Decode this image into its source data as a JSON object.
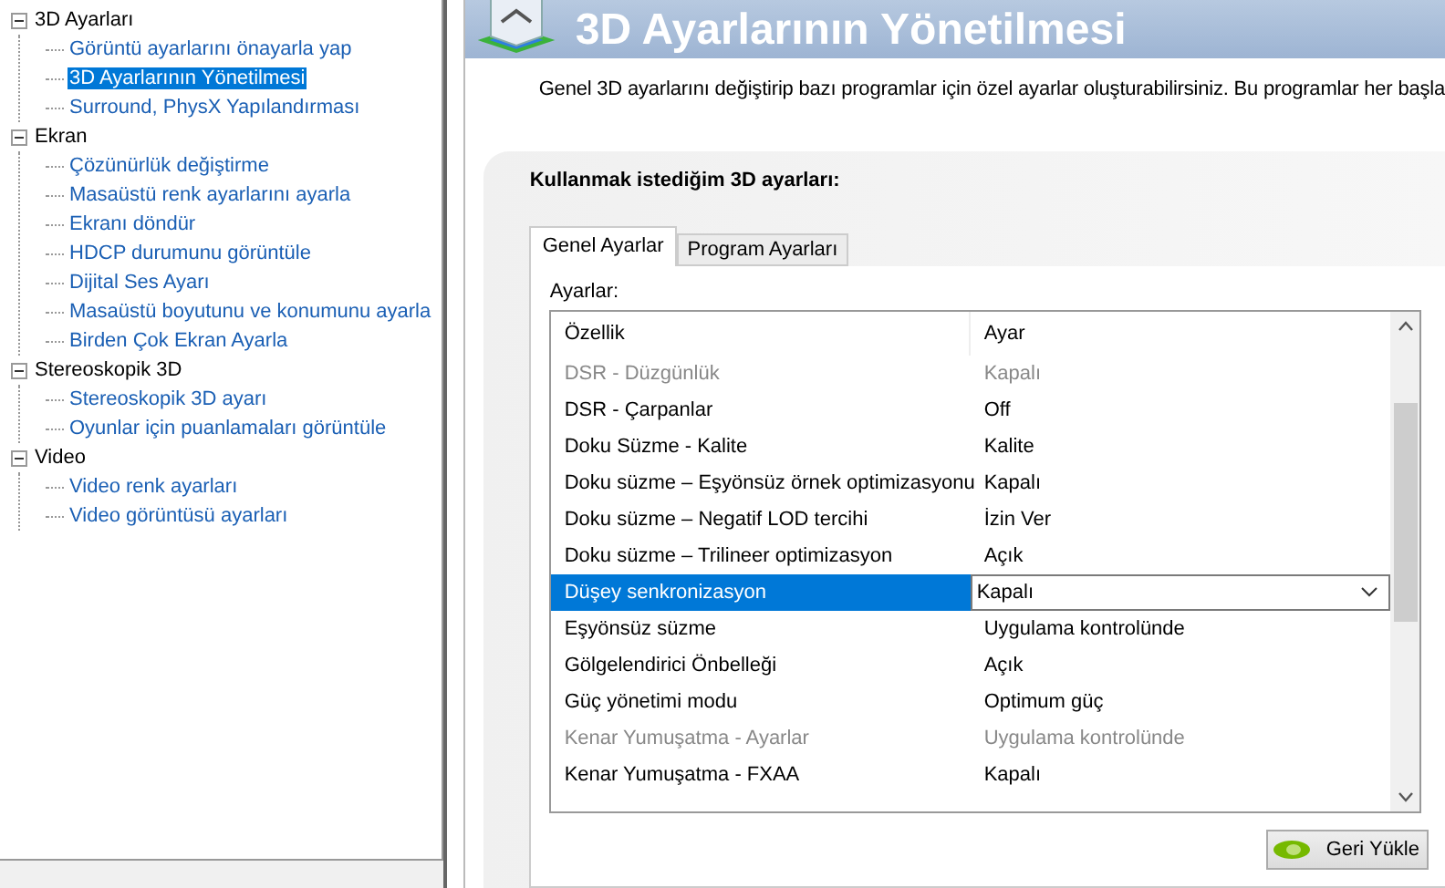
{
  "tree": [
    {
      "label": "3D Ayarları",
      "expanded": true,
      "selected": false,
      "children": [
        {
          "label": "Görüntü ayarlarını önayarla yap",
          "selected": false
        },
        {
          "label": "3D Ayarlarının Yönetilmesi",
          "selected": true
        },
        {
          "label": "Surround, PhysX Yapılandırması",
          "selected": false
        }
      ]
    },
    {
      "label": "Ekran",
      "expanded": true,
      "selected": false,
      "children": [
        {
          "label": "Çözünürlük değiştirme",
          "selected": false
        },
        {
          "label": "Masaüstü renk ayarlarını ayarla",
          "selected": false
        },
        {
          "label": "Ekranı döndür",
          "selected": false
        },
        {
          "label": "HDCP durumunu görüntüle",
          "selected": false
        },
        {
          "label": "Dijital Ses Ayarı",
          "selected": false
        },
        {
          "label": "Masaüstü boyutunu ve konumunu ayarla",
          "selected": false
        },
        {
          "label": "Birden Çok Ekran Ayarla",
          "selected": false
        }
      ]
    },
    {
      "label": "Stereoskopik 3D",
      "expanded": true,
      "selected": false,
      "children": [
        {
          "label": "Stereoskopik 3D ayarı",
          "selected": false
        },
        {
          "label": "Oyunlar için puanlamaları görüntüle",
          "selected": false
        }
      ]
    },
    {
      "label": "Video",
      "expanded": true,
      "selected": false,
      "children": [
        {
          "label": "Video renk ayarları",
          "selected": false
        },
        {
          "label": "Video görüntüsü ayarları",
          "selected": false
        }
      ]
    }
  ],
  "page": {
    "title": "3D Ayarlarının Yönetilmesi",
    "description": "Genel 3D ayarlarını değiştirip bazı programlar için özel ayarlar oluşturabilirsiniz. Bu programlar her başla"
  },
  "settings": {
    "heading": "Kullanmak istediğim 3D ayarları:",
    "tabs": [
      {
        "label": "Genel Ayarlar",
        "selected": true
      },
      {
        "label": "Program Ayarları",
        "selected": false
      }
    ],
    "list_label": "Ayarlar:",
    "columns": [
      "Özellik",
      "Ayar"
    ],
    "rows": [
      {
        "feature": "DSR - Düzgünlük",
        "value": "Kapalı",
        "disabled": true,
        "selected": false
      },
      {
        "feature": "DSR - Çarpanlar",
        "value": "Off",
        "disabled": false,
        "selected": false
      },
      {
        "feature": "Doku Süzme - Kalite",
        "value": "Kalite",
        "disabled": false,
        "selected": false
      },
      {
        "feature": "Doku süzme – Eşyönsüz örnek optimizasyonu",
        "value": "Kapalı",
        "disabled": false,
        "selected": false
      },
      {
        "feature": "Doku süzme – Negatif LOD tercihi",
        "value": "İzin Ver",
        "disabled": false,
        "selected": false
      },
      {
        "feature": "Doku süzme – Trilineer optimizasyon",
        "value": "Açık",
        "disabled": false,
        "selected": false
      },
      {
        "feature": "Düşey senkronizasyon",
        "value": "Kapalı",
        "disabled": false,
        "selected": true
      },
      {
        "feature": "Eşyönsüz süzme",
        "value": "Uygulama kontrolünde",
        "disabled": false,
        "selected": false
      },
      {
        "feature": "Gölgelendirici Önbelleği",
        "value": "Açık",
        "disabled": false,
        "selected": false
      },
      {
        "feature": "Güç yönetimi modu",
        "value": "Optimum güç",
        "disabled": false,
        "selected": false
      },
      {
        "feature": "Kenar Yumuşatma - Ayarlar",
        "value": "Uygulama kontrolünde",
        "disabled": true,
        "selected": false
      },
      {
        "feature": "Kenar Yumuşatma - FXAA",
        "value": "Kapalı",
        "disabled": false,
        "selected": false
      }
    ],
    "restore_button": "Geri Yükle"
  }
}
